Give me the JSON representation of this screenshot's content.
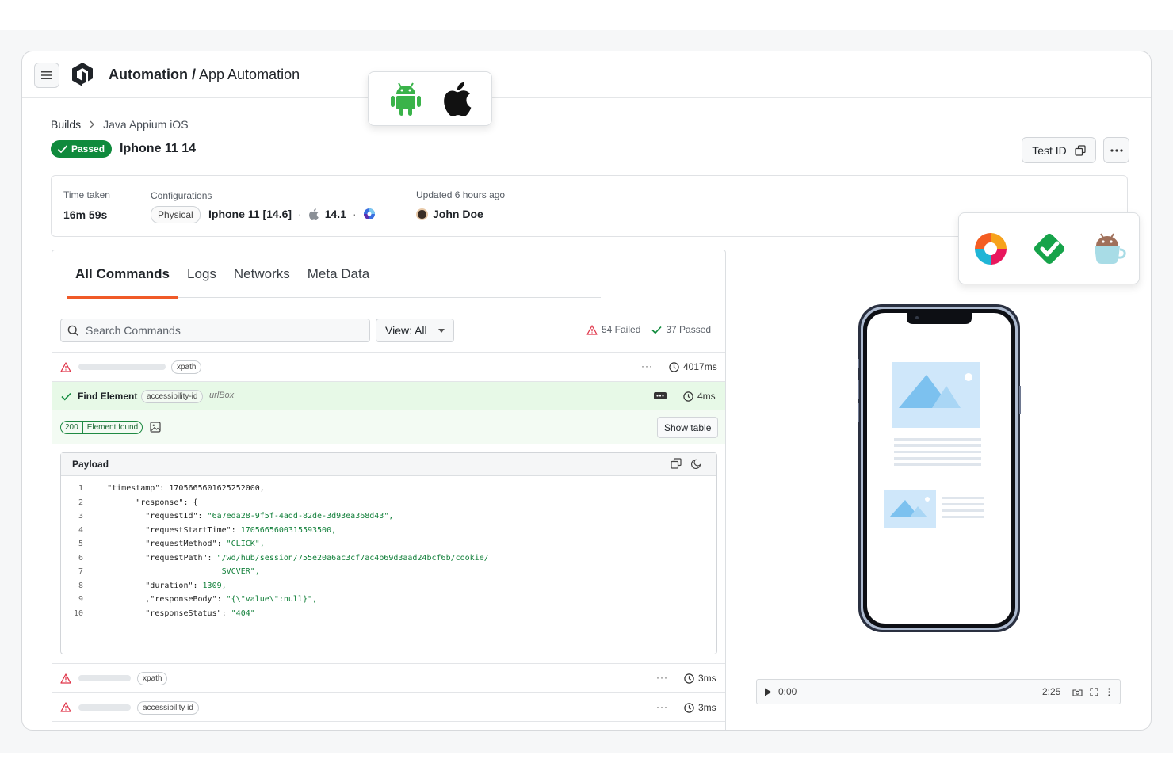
{
  "header": {
    "title_bold": "Automation /",
    "title_rest": " App Automation"
  },
  "breadcrumb": {
    "first": "Builds",
    "current": "Java Appium iOS"
  },
  "build": {
    "status": "Passed",
    "device": "Iphone 11 14",
    "test_id_label": "Test ID"
  },
  "info": {
    "time_label": "Time taken",
    "time_value": "16m 59s",
    "config_label": "Configurations",
    "device_type": "Physical",
    "device_model": "Iphone 11 [14.6]",
    "os_version": "14.1",
    "updated_label": "Updated 6 hours ago",
    "user": "John Doe"
  },
  "tabs": [
    "All Commands",
    "Logs",
    "Networks",
    "Meta Data"
  ],
  "search": {
    "placeholder": "Search Commands"
  },
  "view_select": {
    "value": "View: All"
  },
  "counts": {
    "failed": "54 Failed",
    "passed": "37 Passed"
  },
  "commands": [
    {
      "status": "failed",
      "tag": "xpath",
      "time": "4017ms"
    },
    {
      "status": "passed",
      "name": "Find Element",
      "tag": "accessibility-id",
      "target": "urlBox",
      "time": "4ms"
    },
    {
      "status": "failed",
      "tag": "xpath",
      "time": "3ms"
    },
    {
      "status": "failed",
      "tag": "accessibility id",
      "time": "3ms"
    }
  ],
  "result": {
    "code": "200",
    "message": "Element found",
    "show_table": "Show table"
  },
  "payload": {
    "title": "Payload",
    "lines": [
      {
        "n": "1",
        "indent": "",
        "key": "\"timestamp\": ",
        "val": "1705665601625252000,",
        "val_color": "plain"
      },
      {
        "n": "2",
        "indent": "      ",
        "key": "\"response\": {",
        "val": "",
        "val_color": "plain"
      },
      {
        "n": "3",
        "indent": "        ",
        "key": "\"requestId\": ",
        "val": "\"6a7eda28-9f5f-4add-82de-3d93ea368d43\",",
        "val_color": "green"
      },
      {
        "n": "4",
        "indent": "        ",
        "key": "\"requestStartTime\": ",
        "val": "1705665600315593500,",
        "val_color": "green"
      },
      {
        "n": "5",
        "indent": "        ",
        "key": "\"requestMethod\": ",
        "val": "\"CLICK\",",
        "val_color": "green"
      },
      {
        "n": "6",
        "indent": "        ",
        "key": "\"requestPath\": ",
        "val": "\"/wd/hub/session/755e20a6ac3cf7ac4b69d3aad24bcf6b/cookie/",
        "val_color": "green"
      },
      {
        "n": "7",
        "indent": "                        ",
        "key": "",
        "val": "SVCVER\",",
        "val_color": "green"
      },
      {
        "n": "8",
        "indent": "        ",
        "key": "\"duration\": ",
        "val": "1309,",
        "val_color": "green"
      },
      {
        "n": "9",
        "indent": "        ",
        "key": ",\"responseBody\": ",
        "val": "\"{\\\"value\\\":null}\",",
        "val_color": "green"
      },
      {
        "n": "10",
        "indent": "        ",
        "key": "\"responseStatus\": ",
        "val": "\"404\"",
        "val_color": "green"
      }
    ]
  },
  "media": {
    "current": "0:00",
    "duration": "2:25"
  },
  "colors": {
    "accent": "#f05a28",
    "success": "#0f8a3c",
    "danger": "#e0364a"
  }
}
